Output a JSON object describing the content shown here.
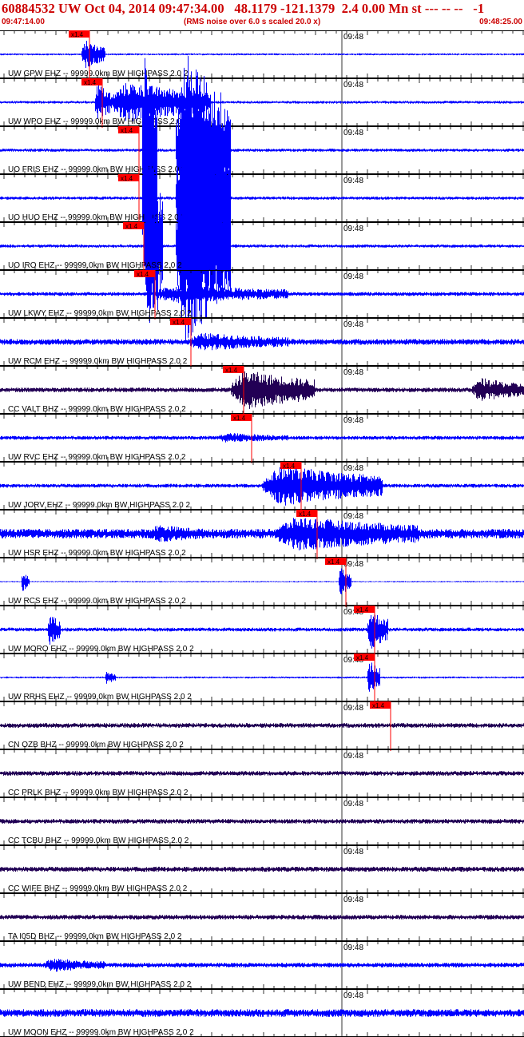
{
  "header": {
    "title": "60884532 UW Oct 04, 2014 09:47:34.00   48.1179 -121.1379  2.4 0.00 Mn st --- -- --   -1",
    "start_time": "09:47:14.00",
    "note": "(RMS noise over 6.0 s scaled 20.0 x)",
    "end_time": "09:48:25.00"
  },
  "minute_label": "09:48",
  "pick_label": "x1.4",
  "colors": {
    "header_text": "#cc0000",
    "trace_blue": "#0000ff",
    "trace_dark": "#220055",
    "pick": "#ff0000",
    "ticks": "#000000"
  },
  "traces": [
    {
      "label": "UW GPW EHZ -- 99999.0km BW  HIGHPASS  2.0  2",
      "pick_fraction": 0.17,
      "color": "blue",
      "noise": 0.05,
      "bursts": [
        {
          "start": 0.155,
          "end": 0.2,
          "amp": 0.7
        }
      ]
    },
    {
      "label": "UW WPO EHZ -- 99999.0km BW  HIGHPASS  2.0  2",
      "pick_fraction": 0.195,
      "color": "blue",
      "noise": 0.07,
      "bursts": [
        {
          "start": 0.18,
          "end": 0.21,
          "amp": 1.0
        },
        {
          "start": 0.21,
          "end": 0.4,
          "amp": 1.0
        }
      ]
    },
    {
      "label": "UO FRIS EHZ -- 99999.0km BW  HIGHPASS  2.0  2",
      "pick_fraction": 0.265,
      "color": "blue",
      "noise": 0.08,
      "bursts": [
        {
          "start": 0.27,
          "end": 0.3,
          "amp": 5.0
        },
        {
          "start": 0.335,
          "end": 0.44,
          "amp": 5.0
        }
      ]
    },
    {
      "label": "UO HUO EHZ -- 99999.0km BW  HIGHPASS  2.0  2",
      "pick_fraction": 0.265,
      "color": "blue",
      "noise": 0.08,
      "bursts": [
        {
          "start": 0.27,
          "end": 0.3,
          "amp": 5.0
        },
        {
          "start": 0.335,
          "end": 0.44,
          "amp": 5.0
        }
      ]
    },
    {
      "label": "UO IRO EHZ -- 99999.0km BW  HIGHPASS  2.0  2",
      "pick_fraction": 0.275,
      "color": "blue",
      "noise": 0.08,
      "bursts": [
        {
          "start": 0.275,
          "end": 0.31,
          "amp": 5.0
        },
        {
          "start": 0.335,
          "end": 0.44,
          "amp": 5.0
        }
      ]
    },
    {
      "label": "UW LKWY EHZ -- 99999.0km BW  HIGHPASS  2.0  2",
      "pick_fraction": 0.295,
      "color": "blue",
      "noise": 0.1,
      "bursts": [
        {
          "start": 0.29,
          "end": 0.55,
          "amp": 0.45
        }
      ]
    },
    {
      "label": "UW RCM EHZ -- 99999.0km BW  HIGHPASS  2.0  2",
      "pick_fraction": 0.365,
      "color": "blue",
      "noise": 0.15,
      "bursts": [
        {
          "start": 0.355,
          "end": 0.55,
          "amp": 0.45
        }
      ]
    },
    {
      "label": "CC VALT BHZ -- 99999.0km BW  HIGHPASS  2.0  2",
      "pick_fraction": 0.465,
      "color": "dark",
      "noise": 0.12,
      "bursts": [
        {
          "start": 0.44,
          "end": 0.6,
          "amp": 1.0
        },
        {
          "start": 0.9,
          "end": 1.0,
          "amp": 0.6
        }
      ]
    },
    {
      "label": "UW RVC EHZ -- 99999.0km BW  HIGHPASS  2.0  2",
      "pick_fraction": 0.48,
      "color": "blue",
      "noise": 0.1,
      "bursts": [
        {
          "start": 0.41,
          "end": 0.55,
          "amp": 0.25
        }
      ]
    },
    {
      "label": "UW JORV EHZ -- 99999.0km BW  HIGHPASS  2.0  2",
      "pick_fraction": 0.575,
      "color": "blue",
      "noise": 0.1,
      "bursts": [
        {
          "start": 0.5,
          "end": 0.73,
          "amp": 1.0
        }
      ]
    },
    {
      "label": "UW HSR EHZ -- 99999.0km BW  HIGHPASS  2.0  2",
      "pick_fraction": 0.605,
      "color": "blue",
      "noise": 0.25,
      "bursts": [
        {
          "start": 0.28,
          "end": 0.4,
          "amp": 0.45
        },
        {
          "start": 0.52,
          "end": 0.8,
          "amp": 0.85
        }
      ]
    },
    {
      "label": "UW RCS EHZ -- 99999.0km BW  HIGHPASS  2.0  2",
      "pick_fraction": 0.66,
      "color": "blue",
      "noise": 0.03,
      "bursts": [
        {
          "start": 0.04,
          "end": 0.055,
          "amp": 0.5
        },
        {
          "start": 0.645,
          "end": 0.67,
          "amp": 0.7
        }
      ]
    },
    {
      "label": "UW MORO EHZ -- 99999.0km BW  HIGHPASS  2.0  2",
      "pick_fraction": 0.715,
      "color": "blue",
      "noise": 0.1,
      "bursts": [
        {
          "start": 0.09,
          "end": 0.115,
          "amp": 0.8
        },
        {
          "start": 0.7,
          "end": 0.74,
          "amp": 1.0
        }
      ]
    },
    {
      "label": "UW RRHS EHZ -- 99999.0km BW  HIGHPASS  2.0  2",
      "pick_fraction": 0.715,
      "color": "blue",
      "noise": 0.05,
      "bursts": [
        {
          "start": 0.2,
          "end": 0.22,
          "amp": 0.35
        },
        {
          "start": 0.7,
          "end": 0.725,
          "amp": 0.9
        }
      ]
    },
    {
      "label": "CN OZB BHZ -- 99999.0km BW  HIGHPASS  2.0  2",
      "pick_fraction": 0.745,
      "color": "dark",
      "noise": 0.12,
      "bursts": []
    },
    {
      "label": "CC PRLK BHZ -- 99999.0km BW  HIGHPASS  2.0  2",
      "pick_fraction": null,
      "color": "dark",
      "noise": 0.12,
      "bursts": []
    },
    {
      "label": "CC TCBU BHZ -- 99999.0km BW  HIGHPASS  2.0  2",
      "pick_fraction": null,
      "color": "dark",
      "noise": 0.12,
      "bursts": []
    },
    {
      "label": "CC WIFE BHZ -- 99999.0km BW  HIGHPASS  2.0  2",
      "pick_fraction": null,
      "color": "dark",
      "noise": 0.13,
      "bursts": []
    },
    {
      "label": "TA I05D BHZ -- 99999.0km BW  HIGHPASS  2.0  2",
      "pick_fraction": null,
      "color": "dark",
      "noise": 0.12,
      "bursts": []
    },
    {
      "label": "UW BEND EHZ -- 99999.0km BW  HIGHPASS  2.0  2",
      "pick_fraction": null,
      "color": "blue",
      "noise": 0.12,
      "bursts": [
        {
          "start": 0.08,
          "end": 0.2,
          "amp": 0.35
        }
      ]
    },
    {
      "label": "UW MOON EHZ -- 99999.0km BW  HIGHPASS  2.0  2",
      "pick_fraction": null,
      "color": "blue",
      "noise": 0.2,
      "bursts": []
    }
  ]
}
